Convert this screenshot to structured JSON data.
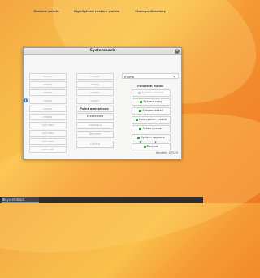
{
  "window": {
    "title": "Systemback",
    "close_glyph": "×"
  },
  "columns": {
    "restore_points": "Restore points",
    "highlighted_restore_points": "Highlighted restore points",
    "storage_directory": "Storage directory"
  },
  "restore_points": [
    "empty",
    "empty",
    "empty",
    "empty",
    "empty",
    "empty",
    "not used",
    "not used",
    "not used",
    "not used"
  ],
  "highlighted_restore_points": [
    "empty",
    "empty",
    "empty",
    "empty",
    "empty"
  ],
  "point_operations": {
    "heading": "Point operations",
    "buttons": [
      "Create new",
      "Highlight",
      "Rename",
      "Delete"
    ]
  },
  "storage": {
    "path": "/home",
    "arrow": "▾"
  },
  "function_menu": {
    "heading": "Function menu",
    "items": [
      {
        "label": "System restore",
        "enabled": false
      },
      {
        "label": "System copy",
        "enabled": true
      },
      {
        "label": "System install",
        "enabled": true
      },
      {
        "label": "Live system create",
        "enabled": true
      },
      {
        "label": "System repair",
        "enabled": true
      },
      {
        "label": "System upgrade",
        "enabled": true
      },
      {
        "label": "Exclude",
        "enabled": true
      }
    ]
  },
  "nav": {
    "prev": "‹",
    "next": "›"
  },
  "info_glyph": "i",
  "kernel_credit": "Kendek, GPLv3",
  "taskbar": {
    "app": "Systemback"
  }
}
